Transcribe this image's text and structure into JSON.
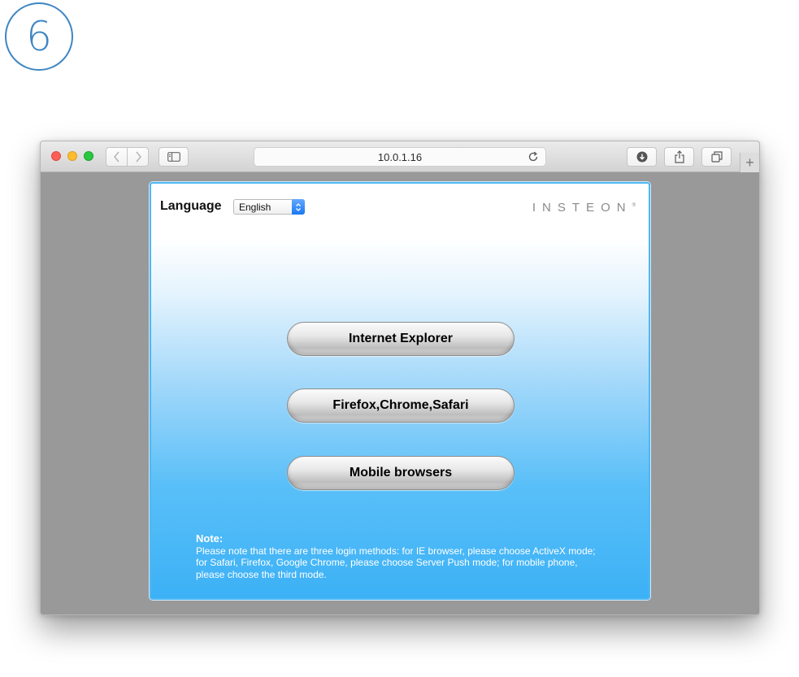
{
  "step": {
    "number": "6"
  },
  "browser": {
    "address": "10.0.1.16",
    "new_tab": "+"
  },
  "page": {
    "language_label": "Language",
    "language_selected": "English",
    "brand": "INSTEON",
    "brand_mark": "®",
    "buttons": [
      {
        "label": "Internet Explorer"
      },
      {
        "label": "Firefox,Chrome,Safari"
      },
      {
        "label": "Mobile browsers"
      }
    ],
    "note_title": "Note:",
    "note_text": "Please note that there are three login methods: for IE browser, please choose ActiveX mode; for Safari, Firefox, Google Chrome, please choose Server Push mode; for mobile phone, please choose the third mode."
  },
  "colors": {
    "badge": "#3f86c2",
    "panel_bottom": "#3cb1f6",
    "select_arrow": "#1a78f2"
  },
  "icons": {
    "back": "chevron-left-icon",
    "forward": "chevron-right-icon",
    "sidebar": "sidebar-icon",
    "reload": "reload-icon",
    "download": "download-icon",
    "share": "share-icon",
    "tabs": "tabs-overview-icon",
    "select_arrow": "up-down-chevron-icon"
  }
}
